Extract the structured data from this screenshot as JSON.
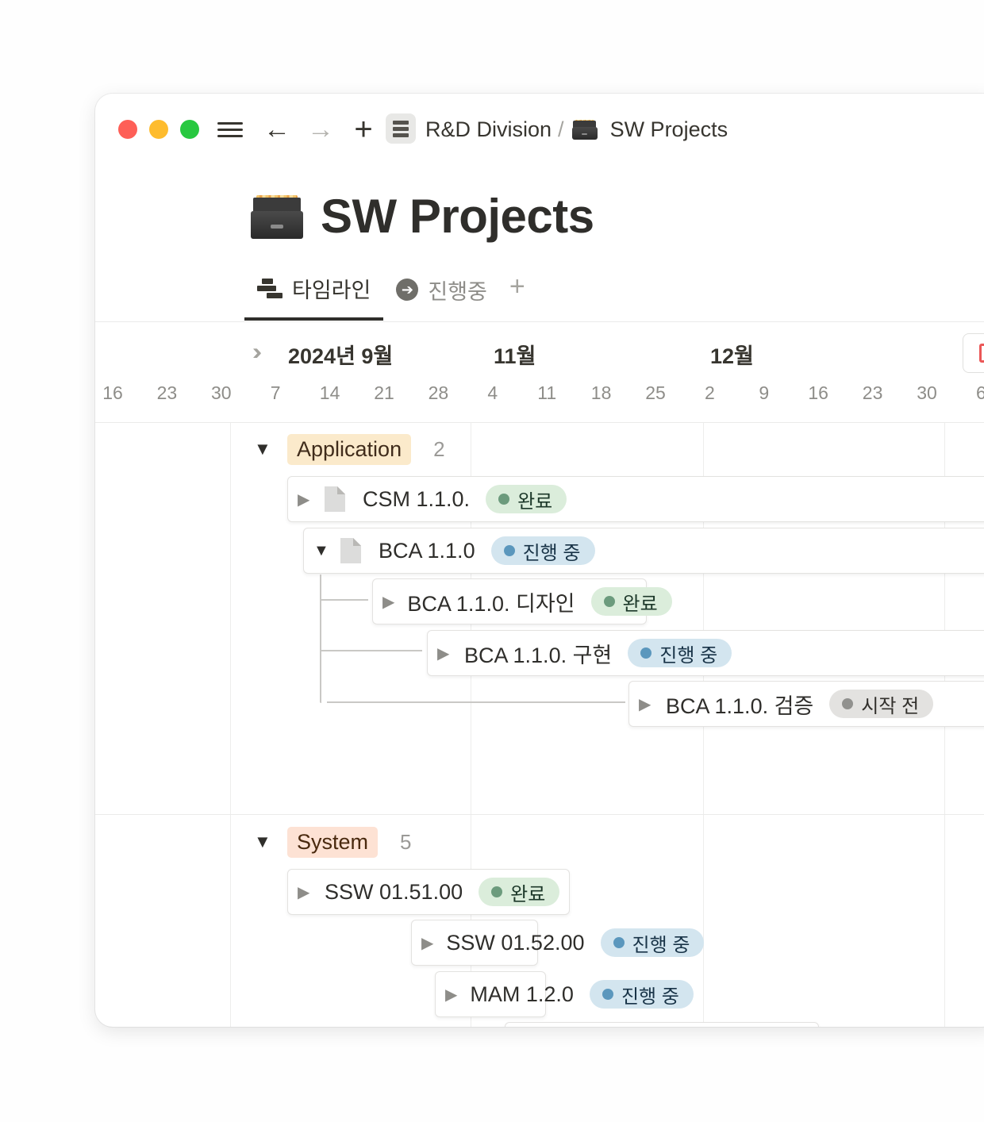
{
  "topbar": {
    "breadcrumb_parent": "R&D Division",
    "breadcrumb_sep": "/",
    "breadcrumb_current": "SW Projects"
  },
  "page": {
    "title": "SW Projects"
  },
  "tabs": [
    {
      "label": "타임라인",
      "active": true
    },
    {
      "label": "진행중",
      "active": false
    }
  ],
  "tab_add": "+",
  "calendar": {
    "months": [
      "2024년 9월",
      "11월",
      "12월"
    ],
    "days": [
      "16",
      "23",
      "30",
      "7",
      "14",
      "21",
      "28",
      "4",
      "11",
      "18",
      "25",
      "2",
      "9",
      "16",
      "23",
      "30",
      "6"
    ]
  },
  "groups": [
    {
      "name": "Application",
      "count": "2",
      "tasks": [
        {
          "title": "CSM 1.1.0.",
          "status": "완료",
          "has_doc_icon": true
        },
        {
          "title": "BCA 1.1.0",
          "status": "진행 중",
          "has_doc_icon": true,
          "expanded": true
        },
        {
          "title": "BCA 1.1.0. 디자인",
          "status": "완료"
        },
        {
          "title": "BCA 1.1.0. 구현",
          "status": "진행 중"
        },
        {
          "title": "BCA 1.1.0. 검증",
          "status": "시작 전"
        }
      ]
    },
    {
      "name": "System",
      "count": "5",
      "tasks": [
        {
          "title": "SSW 01.51.00",
          "status": "완료"
        },
        {
          "title": "SSW 01.52.00",
          "status": "진행 중"
        },
        {
          "title": "MAM 1.2.0",
          "status": "진행 중"
        }
      ]
    }
  ],
  "colors": {
    "done_bg": "#dbeddb",
    "done_dot": "#6c9b7d",
    "progress_bg": "#d3e5ef",
    "progress_dot": "#5b97bd",
    "todo_bg": "#e3e2e0",
    "todo_dot": "#91918e",
    "application_tag": "#fbeacb",
    "system_tag": "#fde2d4"
  }
}
